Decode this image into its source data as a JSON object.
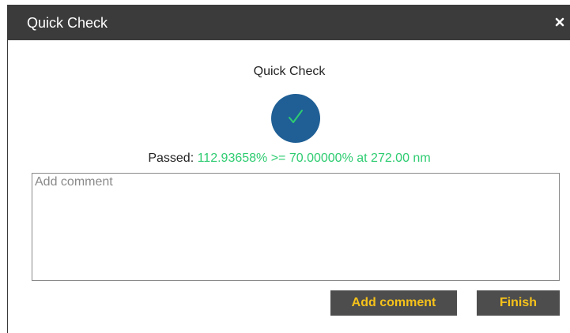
{
  "dialog": {
    "title": "Quick Check",
    "close_icon": "close-icon"
  },
  "content": {
    "heading": "Quick Check",
    "status_icon": "checkmark-icon",
    "result_label": "Passed:",
    "result_value": "112.93658% >= 70.00000% at 272.00 nm"
  },
  "comment": {
    "placeholder": "Add comment",
    "value": ""
  },
  "buttons": {
    "add_comment": "Add comment",
    "finish": "Finish"
  },
  "colors": {
    "titlebar": "#3b3b3b",
    "badge": "#1f5f95",
    "check": "#2ecc71",
    "result_value": "#2ecc71",
    "button_bg": "#4d4d4d",
    "button_text": "#f6c21a"
  }
}
